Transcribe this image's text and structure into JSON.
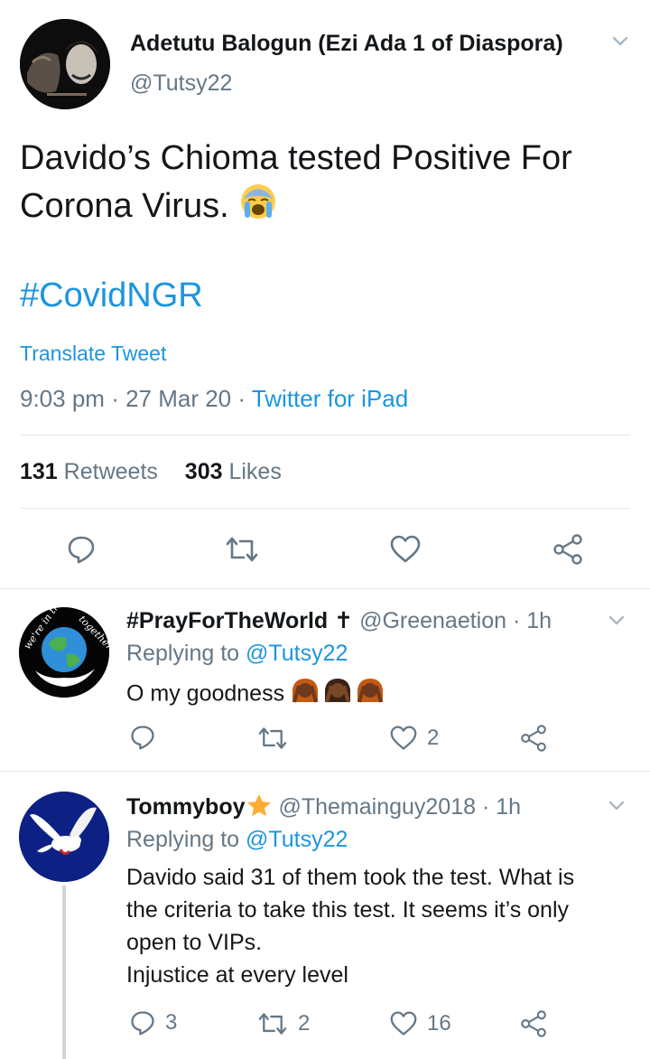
{
  "main_tweet": {
    "author_name": "Adetutu Balogun (Ezi Ada 1 of Diaspora)",
    "author_handle": "@Tutsy22",
    "text_line1": "Davido’s Chioma tested Positive For",
    "text_line2": "Corona Virus.",
    "hashtag": "#CovidNGR",
    "translate_label": "Translate Tweet",
    "time": "9:03 pm",
    "date": "27 Mar 20",
    "source": "Twitter for iPad",
    "retweets_count": "131",
    "retweets_label": "Retweets",
    "likes_count": "303",
    "likes_label": "Likes"
  },
  "replies": [
    {
      "author_name": "#PrayForTheWorld",
      "name_suffix": "✝",
      "handle": "@Greenaetion",
      "age": "1h",
      "replying_label": "Replying to",
      "replying_to": "@Tutsy22",
      "text": "O my goodness",
      "reply_count": "",
      "retweet_count": "",
      "like_count": "2"
    },
    {
      "author_name": "Tommyboy",
      "handle": "@Themainguy2018",
      "age": "1h",
      "replying_label": "Replying to",
      "replying_to": "@Tutsy22",
      "text_lines": [
        "Davido said 31 of them took the test. What is",
        "the criteria to take this test.  It seems it’s only",
        "open to VIPs.",
        "Injustice at every level"
      ],
      "reply_count": "3",
      "retweet_count": "2",
      "like_count": "16"
    }
  ],
  "colors": {
    "accent": "#1b95e0",
    "secondary_text": "#657786",
    "divider": "#e1e8ed"
  }
}
